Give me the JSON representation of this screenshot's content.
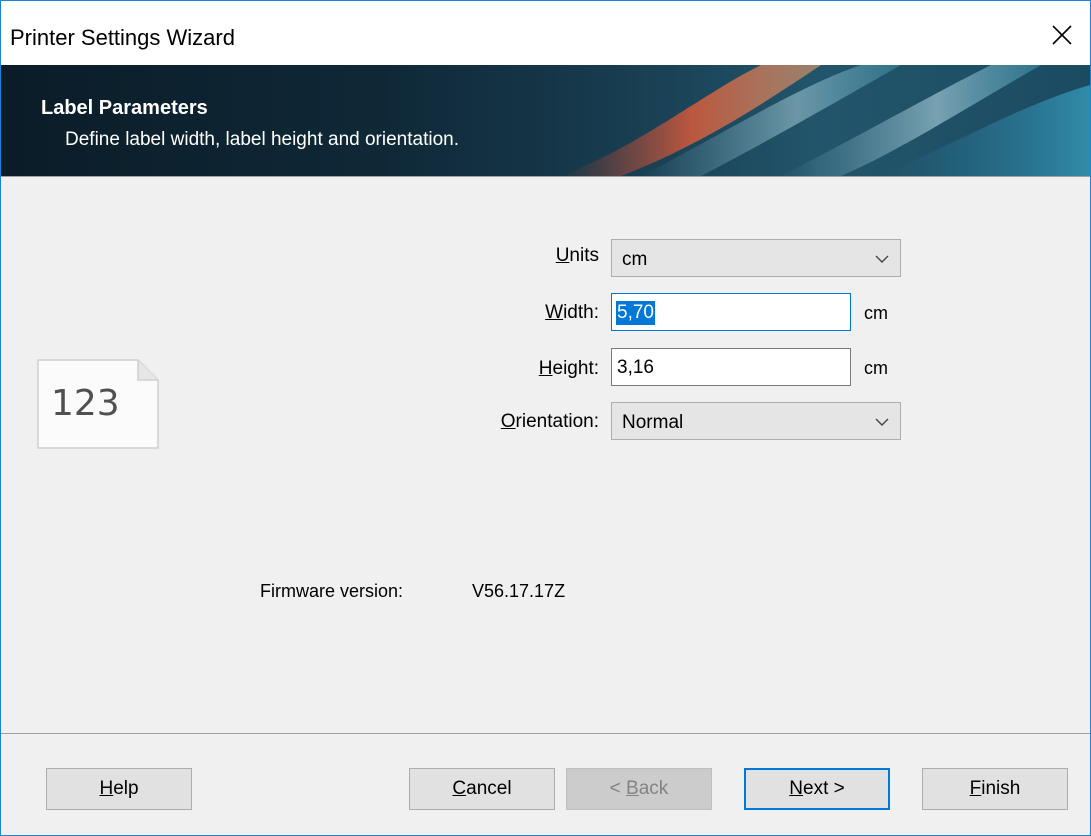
{
  "window": {
    "title": "Printer Settings Wizard",
    "close_glyph": "✕"
  },
  "banner": {
    "title": "Label Parameters",
    "subtitle": "Define label width, label height and orientation."
  },
  "label_icon": {
    "text": "123"
  },
  "form": {
    "units": {
      "label_mnemonic": "U",
      "label_rest": "nits",
      "value": "cm"
    },
    "width": {
      "label_mnemonic": "W",
      "label_rest": "idth:",
      "value": "5,70",
      "unit": "cm"
    },
    "height": {
      "label_mnemonic": "H",
      "label_rest": "eight:",
      "value": "3,16",
      "unit": "cm"
    },
    "orientation": {
      "label_mnemonic": "O",
      "label_rest": "rientation:",
      "value": "Normal"
    }
  },
  "firmware": {
    "label": "Firmware version:",
    "value": "V56.17.17Z"
  },
  "buttons": {
    "help": {
      "mnemonic": "H",
      "rest": "elp"
    },
    "cancel": {
      "mnemonic": "C",
      "rest": "ancel"
    },
    "back": {
      "prefix": "< ",
      "mnemonic": "B",
      "rest": "ack"
    },
    "next": {
      "mnemonic": "N",
      "rest": "ext >"
    },
    "finish": {
      "mnemonic": "F",
      "rest": "inish"
    }
  },
  "colors": {
    "accent": "#0078d7",
    "window_border": "#1883d7",
    "dialog_bg": "#f0f0f0"
  }
}
